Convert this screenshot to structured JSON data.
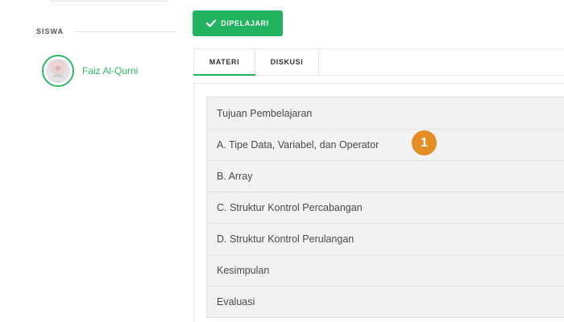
{
  "sidebar": {
    "heading": "SISWA",
    "student": {
      "name": "Faiz Al-Qurni"
    }
  },
  "main": {
    "done_button": {
      "label": "DIPELAJARI",
      "icon": "check-icon"
    },
    "tabs": [
      {
        "label": "MATERI",
        "active": true
      },
      {
        "label": "DISKUSI",
        "active": false
      }
    ],
    "materials": [
      "Tujuan Pembelajaran",
      "A. Tipe Data, Variabel, dan Operator",
      "B. Array",
      "C. Struktur Kontrol Percabangan",
      "D. Struktur Kontrol Perulangan",
      "Kesimpulan",
      "Evaluasi"
    ],
    "step_badge": "1"
  },
  "colors": {
    "accent_green": "#22b35e",
    "name_green": "#2fb866",
    "badge_orange": "#e58d25",
    "list_background": "#f2f2f2"
  }
}
